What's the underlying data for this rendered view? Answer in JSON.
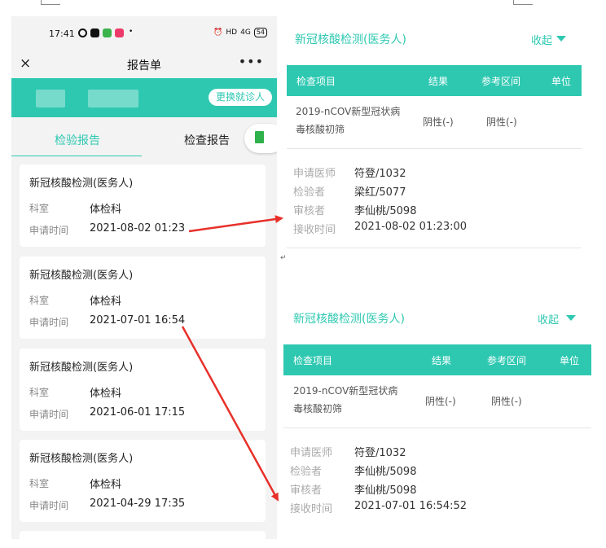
{
  "phone": {
    "status": {
      "time": "17:41",
      "right": "HD",
      "network": "4G",
      "battery": "54"
    },
    "nav": {
      "close": "×",
      "title": "报告单",
      "more": "•••"
    },
    "patient": {
      "switch_label": "更换就诊人"
    },
    "tabs": [
      {
        "label": "检验报告"
      },
      {
        "label": "检查报告"
      }
    ],
    "reports": [
      {
        "title": "新冠核酸检测(医务人)",
        "dept_label": "科室",
        "dept": "体检科",
        "time_label": "申请时间",
        "time": "2021-08-02 01:23"
      },
      {
        "title": "新冠核酸检测(医务人)",
        "dept_label": "科室",
        "dept": "体检科",
        "time_label": "申请时间",
        "time": "2021-07-01 16:54"
      },
      {
        "title": "新冠核酸检测(医务人)",
        "dept_label": "科室",
        "dept": "体检科",
        "time_label": "申请时间",
        "time": "2021-06-01 17:15"
      },
      {
        "title": "新冠核酸检测(医务人)",
        "dept_label": "科室",
        "dept": "体检科",
        "time_label": "申请时间",
        "time": "2021-04-29 17:35"
      }
    ]
  },
  "panels": [
    {
      "title": "新冠核酸检测(医务人)",
      "collapse": "收起",
      "headers": [
        "检查项目",
        "结果",
        "参考区间",
        "单位"
      ],
      "item": "2019-nCOV新型冠状病毒核酸初筛",
      "result": "阴性(-)",
      "ref": "阴性(-)",
      "info": [
        {
          "k": "申请医师",
          "v": "符登/1032"
        },
        {
          "k": "检验者",
          "v": "梁红/5077"
        },
        {
          "k": "审核者",
          "v": "李仙桃/5098"
        },
        {
          "k": "接收时间",
          "v": "2021-08-02 01:23:00"
        }
      ]
    },
    {
      "title": "新冠核酸检测(医务人)",
      "collapse": "收起",
      "headers": [
        "检查项目",
        "结果",
        "参考区间",
        "单位"
      ],
      "item": "2019-nCOV新型冠状病毒核酸初筛",
      "result": "阴性(-)",
      "ref": "阴性(-)",
      "info": [
        {
          "k": "申请医师",
          "v": "符登/1032"
        },
        {
          "k": "检验者",
          "v": "李仙桃/5098"
        },
        {
          "k": "审核者",
          "v": "李仙桃/5098"
        },
        {
          "k": "接收时间",
          "v": "2021-07-01 16:54:52"
        }
      ]
    }
  ],
  "annotation": {
    "return_mark": "↵",
    "arrow_color": "#e8302a"
  },
  "colors": {
    "accent": "#2ec8b1",
    "background": "#f3f3f3"
  }
}
